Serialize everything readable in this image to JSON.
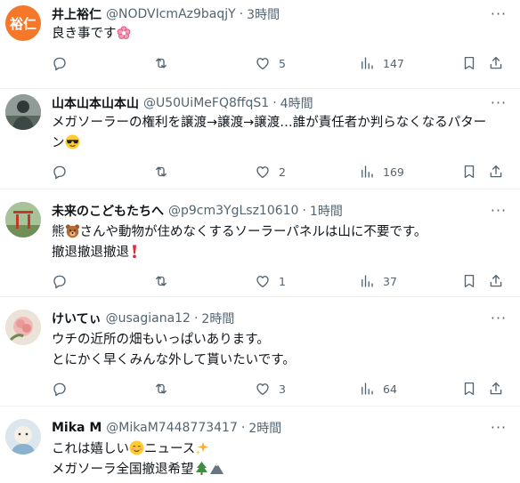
{
  "posts": [
    {
      "name": "井上裕仁",
      "handle": "@NODVIcmAz9baqjY",
      "separator": "·",
      "time": "3時間",
      "avatar_text": "裕仁",
      "avatar_color": "#f4772a",
      "lines": [
        "良き事です"
      ],
      "replies": "",
      "reposts": "",
      "likes": "5",
      "views": "147"
    },
    {
      "name": "山本山本山本山",
      "handle": "@U50UiMeFQ8ffqS1",
      "separator": "·",
      "time": "4時間",
      "lines": [
        "メガソーラーの権利を譲渡→譲渡→譲渡…誰が責任者か判らなくなるパター",
        "ン"
      ],
      "replies": "",
      "reposts": "",
      "likes": "2",
      "views": "169"
    },
    {
      "name": "未来のこどもたちへ",
      "handle": "@p9cm3YgLsz10610",
      "separator": "·",
      "time": "1時間",
      "lines": [
        "熊",
        "さんや動物が住めなくするソーラーパネルは山に不要です。",
        "撤退撤退撤退"
      ],
      "replies": "",
      "reposts": "",
      "likes": "1",
      "views": "37"
    },
    {
      "name": "けいてぃ",
      "handle": "@usagiana12",
      "separator": "·",
      "time": "2時間",
      "lines": [
        "ウチの近所の畑もいっぱいあります。",
        "とにかく早くみんな外して貰いたいです。"
      ],
      "replies": "",
      "reposts": "",
      "likes": "3",
      "views": "64"
    },
    {
      "name": "Mika M",
      "handle": "@MikaM7448773417",
      "separator": "·",
      "time": "2時間",
      "lines": [
        "これは嬉しい",
        "ニュース",
        "メガソーラ全国撤退希望"
      ],
      "replies": "",
      "reposts": "",
      "likes": "",
      "views": ""
    }
  ],
  "more_label": "···",
  "icons": [
    "reply-icon",
    "repost-icon",
    "like-icon",
    "views-icon",
    "bookmark-icon",
    "share-icon"
  ]
}
